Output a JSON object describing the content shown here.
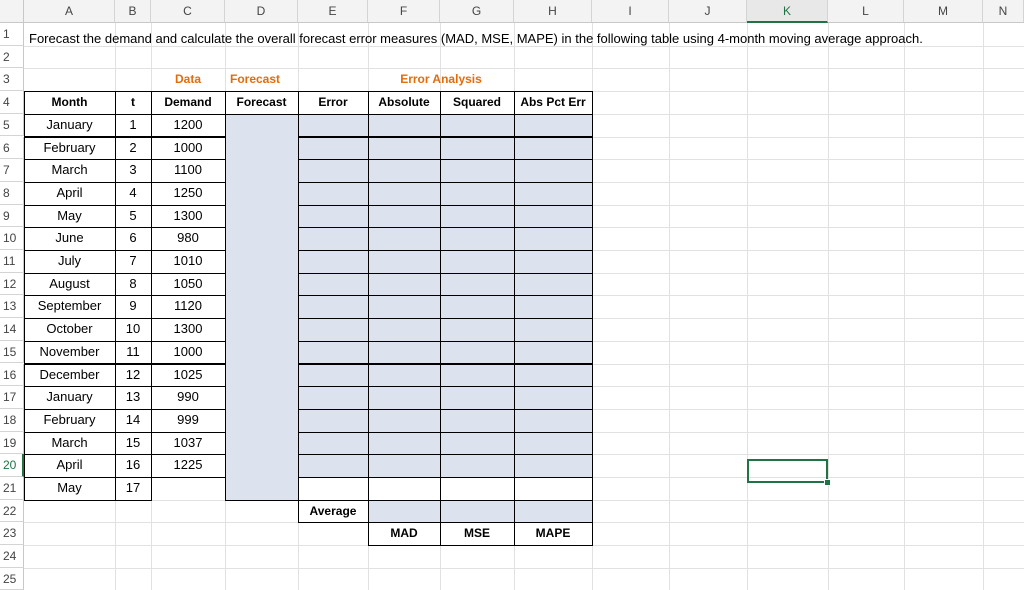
{
  "columns": [
    "A",
    "B",
    "C",
    "D",
    "E",
    "F",
    "G",
    "H",
    "I",
    "J",
    "K",
    "L",
    "M",
    "N"
  ],
  "rows": [
    "1",
    "2",
    "3",
    "4",
    "5",
    "6",
    "7",
    "8",
    "9",
    "10",
    "11",
    "12",
    "13",
    "14",
    "15",
    "16",
    "17",
    "18",
    "19",
    "20",
    "21",
    "22",
    "23",
    "24",
    "25"
  ],
  "selected_cell": "K20",
  "title": "Forecast the demand and calculate the overall forecast error measures (MAD, MSE, MAPE) in the following table using 4-month moving average approach.",
  "group_headers": {
    "data": "Data",
    "forecast": "Forecast",
    "error_analysis": "Error Analysis"
  },
  "table_headers": [
    "Month",
    "t",
    "Demand",
    "Forecast",
    "Error",
    "Absolute",
    "Squared",
    "Abs Pct Err"
  ],
  "table_rows": [
    {
      "month": "January",
      "t": "1",
      "demand": "1200"
    },
    {
      "month": "February",
      "t": "2",
      "demand": "1000"
    },
    {
      "month": "March",
      "t": "3",
      "demand": "1100"
    },
    {
      "month": "April",
      "t": "4",
      "demand": "1250"
    },
    {
      "month": "May",
      "t": "5",
      "demand": "1300"
    },
    {
      "month": "June",
      "t": "6",
      "demand": "980"
    },
    {
      "month": "July",
      "t": "7",
      "demand": "1010"
    },
    {
      "month": "August",
      "t": "8",
      "demand": "1050"
    },
    {
      "month": "September",
      "t": "9",
      "demand": "1120"
    },
    {
      "month": "October",
      "t": "10",
      "demand": "1300"
    },
    {
      "month": "November",
      "t": "11",
      "demand": "1000"
    },
    {
      "month": "December",
      "t": "12",
      "demand": "1025"
    },
    {
      "month": "January",
      "t": "13",
      "demand": "990"
    },
    {
      "month": "February",
      "t": "14",
      "demand": "999"
    },
    {
      "month": "March",
      "t": "15",
      "demand": "1037"
    },
    {
      "month": "April",
      "t": "16",
      "demand": "1225"
    },
    {
      "month": "May",
      "t": "17",
      "demand": ""
    }
  ],
  "average_label": "Average",
  "summary_labels": [
    "MAD",
    "MSE",
    "MAPE"
  ],
  "colors": {
    "accent": "#217346",
    "orange": "#e46c0a",
    "fill": "#dce3ef"
  }
}
